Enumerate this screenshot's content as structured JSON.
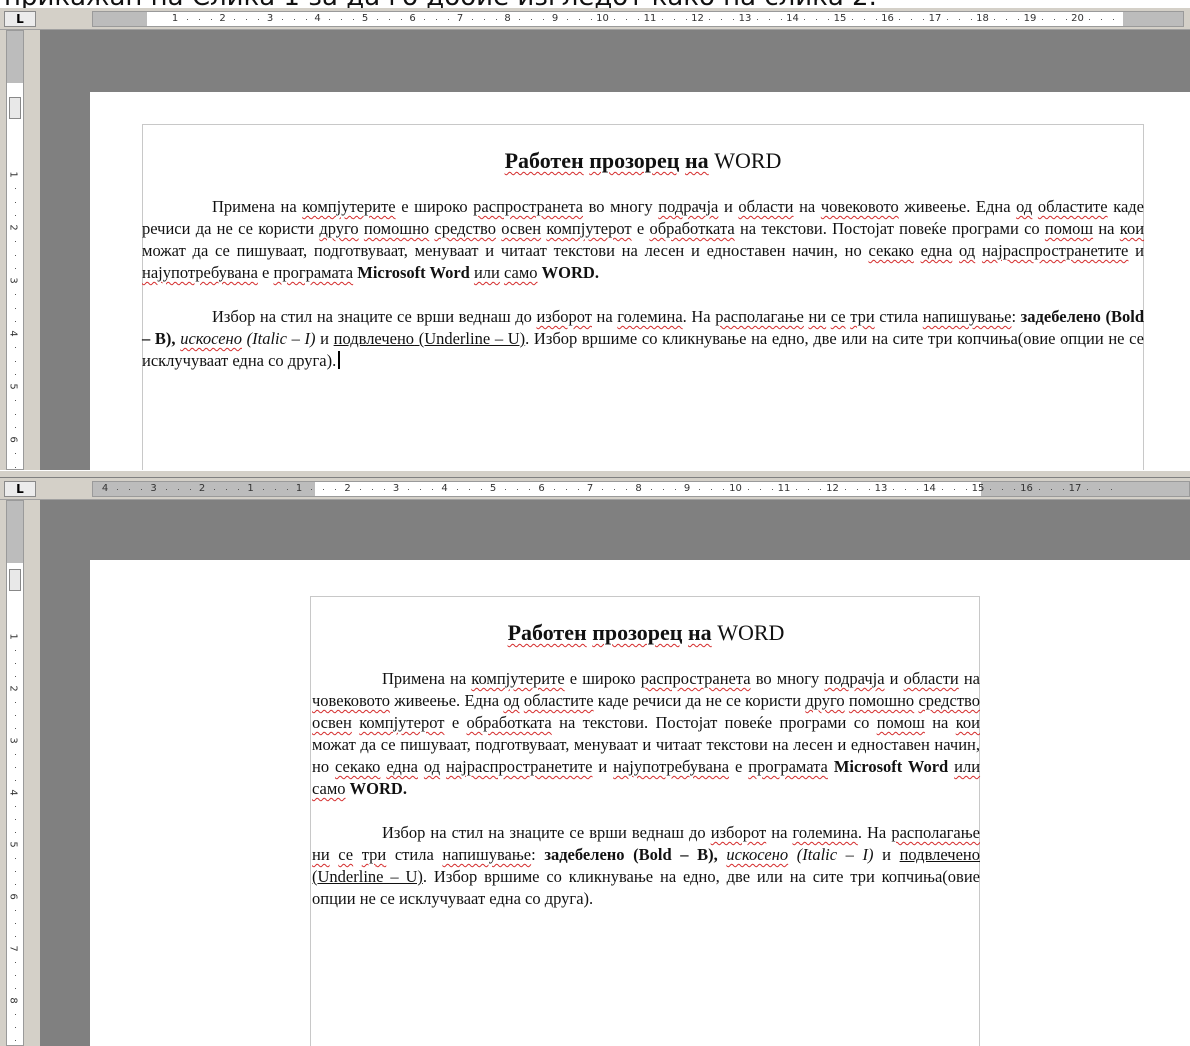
{
  "caption": "прикажан на Слика 1 за да го добие изгледот како на слика 2.",
  "panels": [
    {
      "corner_label": "L",
      "ruler_numbers": [
        "1",
        "2",
        "3",
        "4",
        "5",
        "6",
        "7",
        "8",
        "9",
        "10",
        "11",
        "12",
        "13",
        "14",
        "15",
        "16",
        "17",
        "18",
        "19",
        "20"
      ],
      "vruler_numbers": [
        "1",
        "2",
        "3",
        "4",
        "5",
        "6"
      ],
      "document": {
        "title": {
          "word1": "Работен",
          "word2": "прозорец",
          "word3": "на",
          "word4": "WORD"
        },
        "para1": {
          "t1": "Примена на ",
          "t2": "компјутерите",
          "t3": " е широко ",
          "t4": "распространета",
          "t5": " во многу ",
          "t6": "подрачја",
          "t7": " и ",
          "t8": "области",
          "t9": " на ",
          "t10": "човековото",
          "t11": " живеење. Една ",
          "t12": "од",
          "t13": " ",
          "t14": "областите",
          "t15": " каде речиси да не се користи ",
          "t16": "друго",
          "t17": " ",
          "t18": "помошно",
          "t19": " ",
          "t20": "средство",
          "t21": " ",
          "t22": "освен",
          "t23": " ",
          "t24": "компјутерот",
          "t25": " е ",
          "t26": "обработката",
          "t27": " на текстови. Постојат повеќе програми со ",
          "t28": "помош",
          "t29": " на ",
          "t30": "кои",
          "t31": " можат да се пишуваат, подготвуваат, менуваат и читаат текстови на лесен и едноставен начин, но ",
          "t32": "секако",
          "t33": " ",
          "t34": "една",
          "t35": " ",
          "t36": "од",
          "t37": " ",
          "t38": "најраспространетите",
          "t39": " и ",
          "t40": "најупотребувана",
          "t41": " е ",
          "t42": "програмата",
          "t43": "  ",
          "t44": "Microsoft Word",
          "t45": " ",
          "t46": "или",
          "t47": " ",
          "t48": "само",
          "t49": " ",
          "t50": "WORD."
        },
        "para2": {
          "t1": "Избор на стил на знаците се врши веднаш до ",
          "t2": "изборот",
          "t3": " на ",
          "t4": "големина",
          "t5": ". На ",
          "t6": "располагање",
          "t7": " ",
          "t8": "ни",
          "t9": " ",
          "t10": "се",
          "t11": " ",
          "t12": "три",
          "t13": " стила ",
          "t14": "напишување",
          "t15": ": ",
          "t16": "задебелено",
          "t17": " (Bold – B), ",
          "t18": "искосено",
          "t19": " (Italic – I)",
          "t20": " и ",
          "t21": "подвлечено",
          "t22": " (Underline – U)",
          "t23": ". Избор вршиме со кликнување на едно, две или на сите три копчиња(овие опции не се исклучуваат една со друга)."
        }
      }
    },
    {
      "corner_label": "L",
      "ruler_numbers": [
        "4",
        "3",
        "2",
        "1",
        "1",
        "2",
        "3",
        "4",
        "5",
        "6",
        "7",
        "8",
        "9",
        "10",
        "11",
        "12",
        "13",
        "14",
        "15",
        "16",
        "17"
      ],
      "vruler_numbers": [
        "1",
        "2",
        "3",
        "4",
        "5",
        "6",
        "7",
        "8"
      ]
    }
  ]
}
